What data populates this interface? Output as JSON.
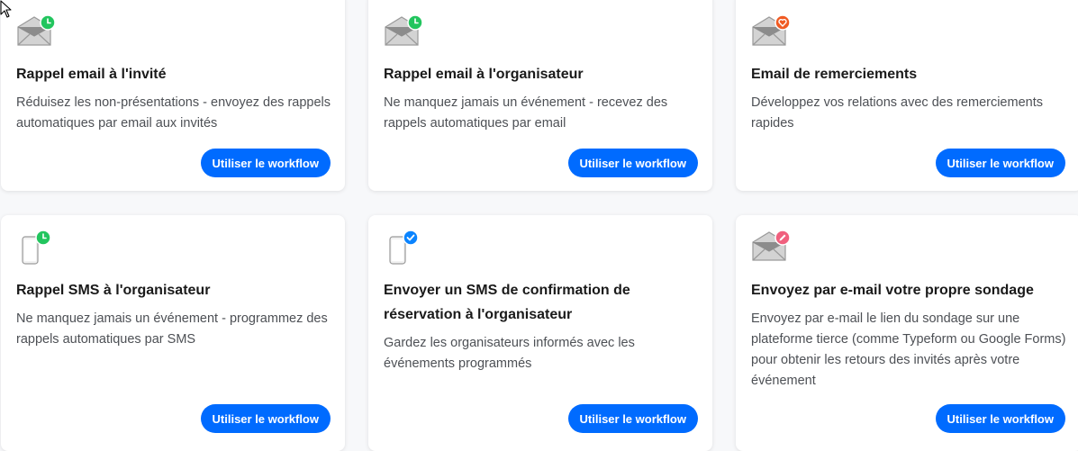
{
  "colors": {
    "accent": "#006bff",
    "badge_clock": "#22c55e",
    "badge_heart": "#f05a22",
    "badge_check": "#0a84ff",
    "badge_pencil": "#f0607e"
  },
  "cards": [
    {
      "icon": "envelope-icon",
      "badge": "clock-badge-icon",
      "title": "Rappel email à l'invité",
      "description": "Réduisez les non-présentations - envoyez des rappels automatiques par email aux invités",
      "button": "Utiliser le workflow"
    },
    {
      "icon": "envelope-icon",
      "badge": "clock-badge-icon",
      "title": "Rappel email à l'organisateur",
      "description": "Ne manquez jamais un événement - recevez des rappels automatiques par email",
      "button": "Utiliser le workflow"
    },
    {
      "icon": "envelope-icon",
      "badge": "heart-badge-icon",
      "title": "Email de remerciements",
      "description": "Développez vos relations avec des remerciements rapides",
      "button": "Utiliser le workflow"
    },
    {
      "icon": "phone-icon",
      "badge": "clock-badge-icon",
      "title": "Rappel SMS à l'organisateur",
      "description": "Ne manquez jamais un événement - programmez des rappels automatiques par SMS",
      "button": "Utiliser le workflow"
    },
    {
      "icon": "phone-icon",
      "badge": "check-badge-icon",
      "title": "Envoyer un SMS de confirmation de réservation à l'organisateur",
      "description": "Gardez les organisateurs informés avec les événements programmés",
      "button": "Utiliser le workflow"
    },
    {
      "icon": "envelope-icon",
      "badge": "pencil-badge-icon",
      "title": "Envoyez par e-mail votre propre sondage",
      "description": "Envoyez par e-mail le lien du sondage sur une plateforme tierce (comme Typeform ou Google Forms) pour obtenir les retours des invités après votre événement",
      "button": "Utiliser le workflow"
    }
  ]
}
